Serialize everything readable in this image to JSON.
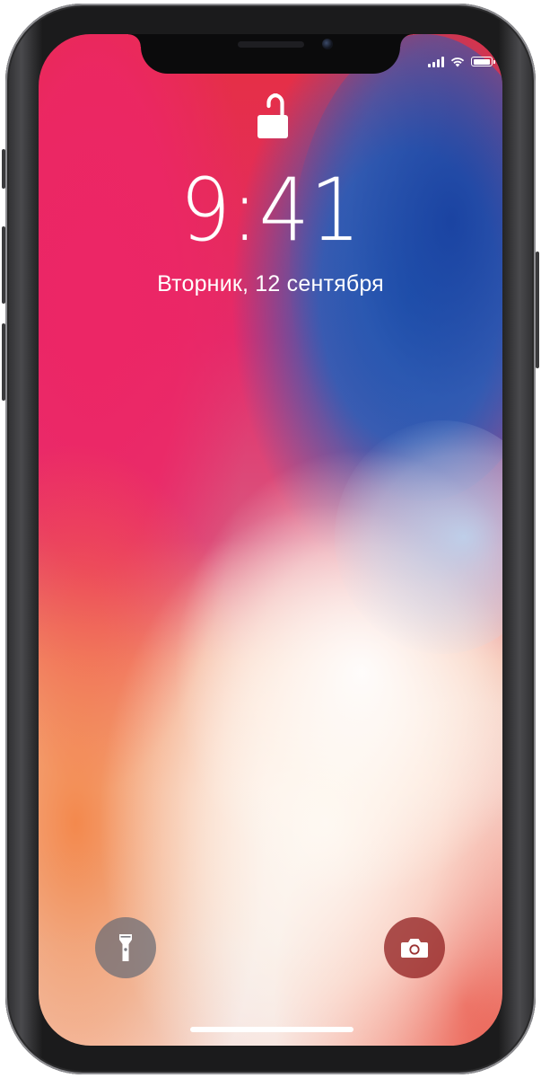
{
  "lockscreen": {
    "time": "9:41",
    "date": "Вторник, 12 сентября"
  },
  "status_bar": {
    "signal_bars_active": 4,
    "signal_bars_total": 4,
    "wifi": "wifi-icon",
    "battery_level": 1.0
  },
  "icons": {
    "lock": "unlocked-padlock-icon",
    "flashlight": "flashlight-icon",
    "camera": "camera-icon"
  },
  "colors": {
    "wallpaper_red": "#e42a6a",
    "wallpaper_blue": "#1e50aa",
    "wallpaper_orange": "#f37e3c",
    "frame": "#1b1b1c"
  }
}
